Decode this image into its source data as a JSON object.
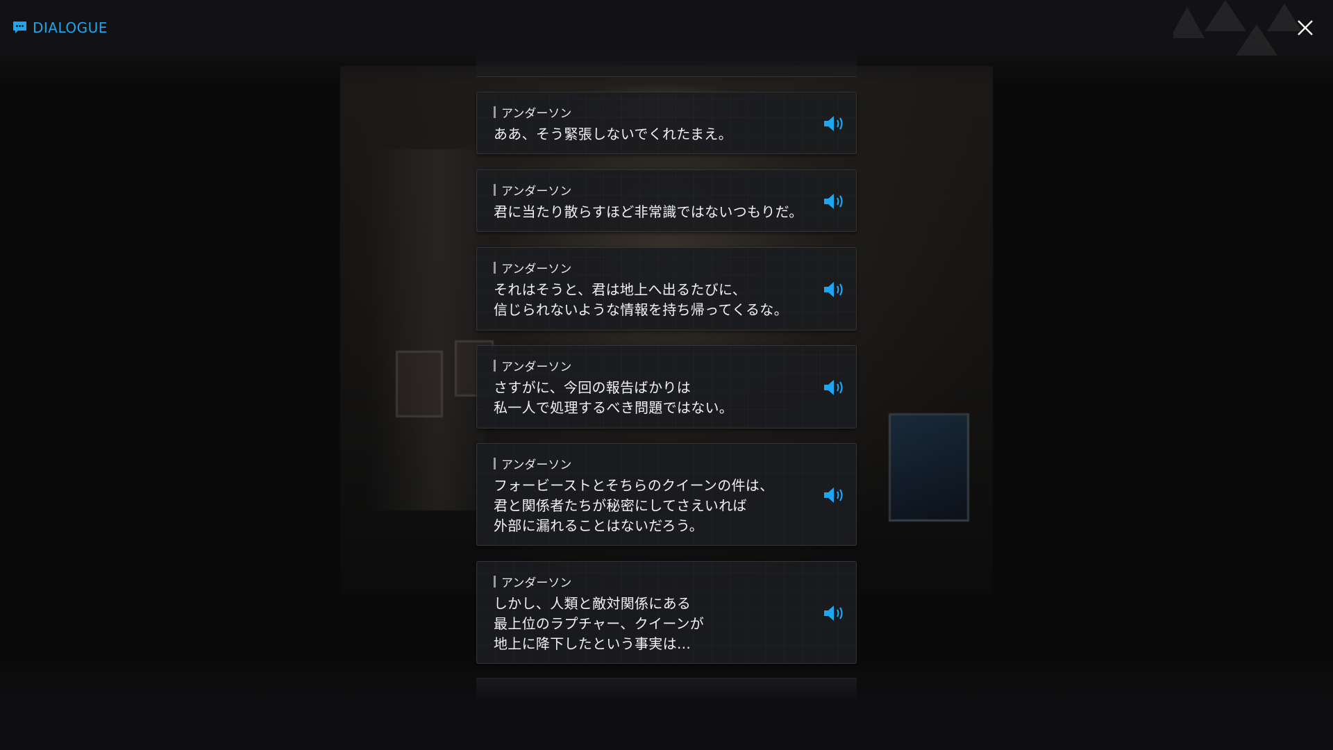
{
  "header": {
    "title": "DIALOGUE",
    "accent_color": "#1ea6f0",
    "icon": "chat-bubble-icon",
    "close_icon": "close-icon"
  },
  "dialogue": [
    {
      "speaker": "アンダーソン",
      "text": "ああ、そう緊張しないでくれたまえ。",
      "voice_icon": "speaker-icon"
    },
    {
      "speaker": "アンダーソン",
      "text": "君に当たり散らすほど非常識ではないつもりだ。",
      "voice_icon": "speaker-icon"
    },
    {
      "speaker": "アンダーソン",
      "text": "それはそうと、君は地上へ出るたびに、\n信じられないような情報を持ち帰ってくるな。",
      "voice_icon": "speaker-icon"
    },
    {
      "speaker": "アンダーソン",
      "text": "さすがに、今回の報告ばかりは\n私一人で処理するべき問題ではない。",
      "voice_icon": "speaker-icon"
    },
    {
      "speaker": "アンダーソン",
      "text": "フォービーストとそちらのクイーンの件は、\n君と関係者たちが秘密にしてさえいれば\n外部に漏れることはないだろう。",
      "voice_icon": "speaker-icon"
    },
    {
      "speaker": "アンダーソン",
      "text": "しかし、人類と敵対関係にある\n最上位のラプチャー、クイーンが\n地上に降下したという事実は…",
      "voice_icon": "speaker-icon"
    }
  ]
}
